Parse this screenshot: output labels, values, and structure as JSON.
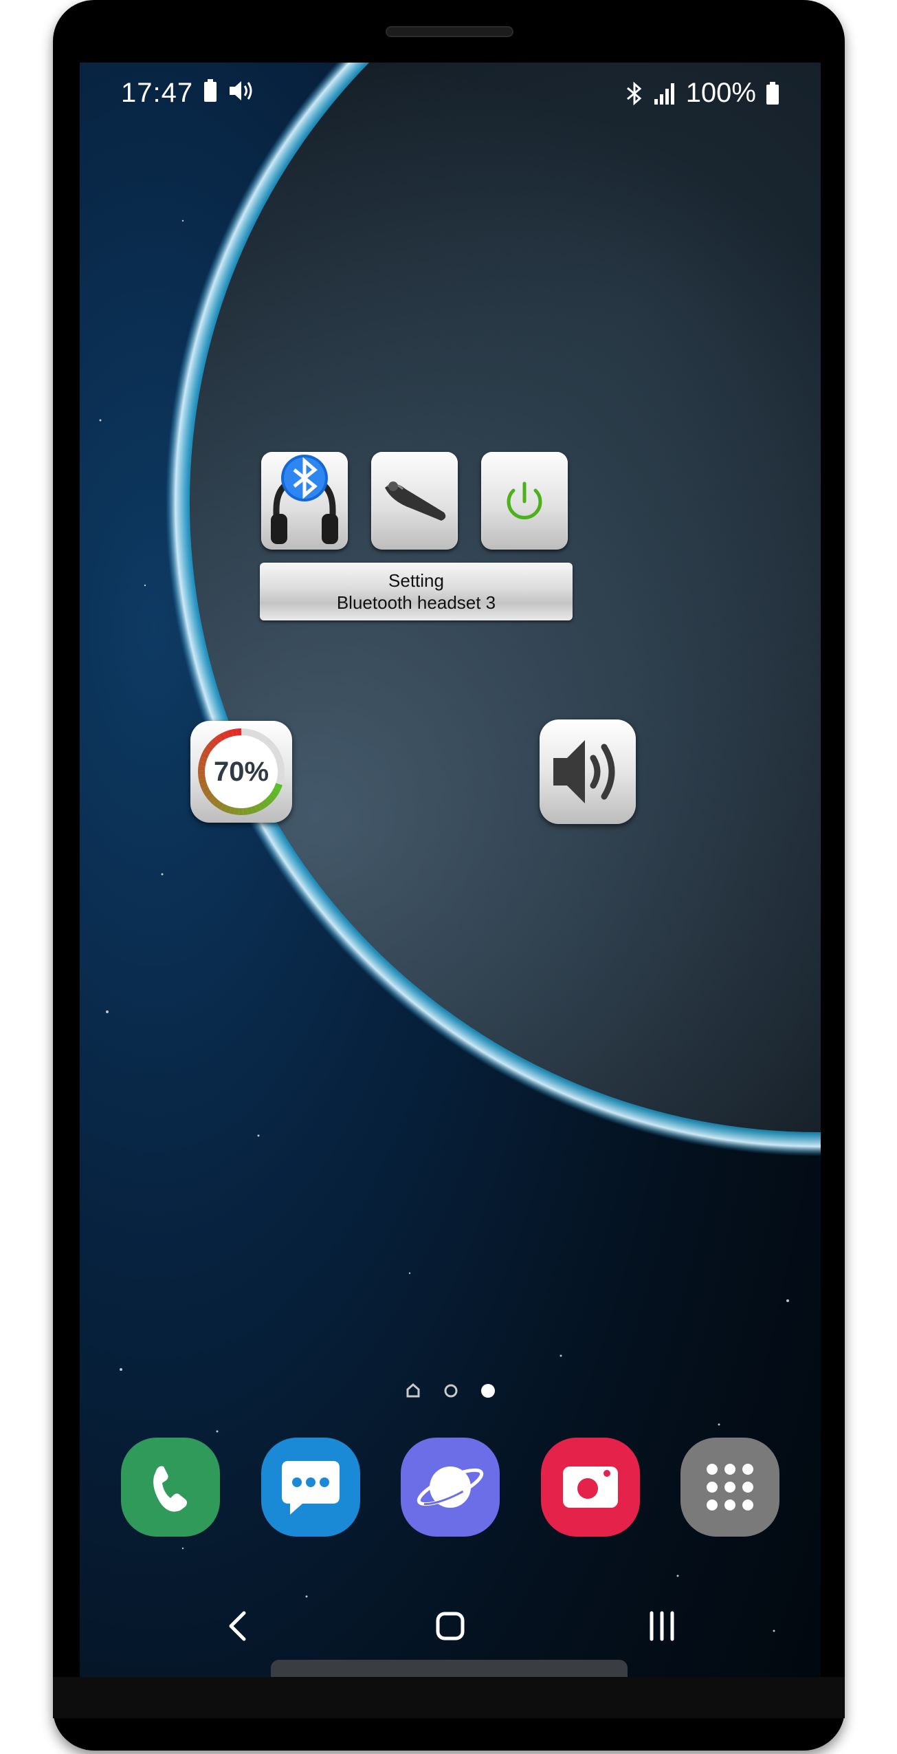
{
  "status_bar": {
    "time": "17:47",
    "battery_percent": "100%",
    "icons_left": [
      "battery-icon",
      "volume-icon"
    ],
    "icons_right": [
      "bluetooth-icon",
      "signal-icon",
      "battery-icon"
    ]
  },
  "widget": {
    "line1": "Setting",
    "line2": "Bluetooth headset 3",
    "tiles": [
      "bluetooth-headphones-icon",
      "bluetooth-earpiece-icon",
      "power-icon"
    ],
    "power_color": "#4cb11a"
  },
  "battery_widget": {
    "percent_text": "70%",
    "level": 0.7
  },
  "volume_widget": {
    "icon": "speaker-icon"
  },
  "page_indicator": {
    "pages": [
      "home",
      "page",
      "page-active"
    ]
  },
  "dock": {
    "apps": [
      {
        "icon": "phone-icon",
        "color": "#2f9a5a"
      },
      {
        "icon": "messages-icon",
        "color": "#1a8ad6"
      },
      {
        "icon": "internet-icon",
        "color": "#6b6ee6"
      },
      {
        "icon": "camera-icon",
        "color": "#e5224a"
      },
      {
        "icon": "apps-icon",
        "color": "#7a7a7a"
      }
    ]
  },
  "nav": {
    "buttons": [
      "back-icon",
      "home-icon",
      "recents-icon"
    ]
  }
}
